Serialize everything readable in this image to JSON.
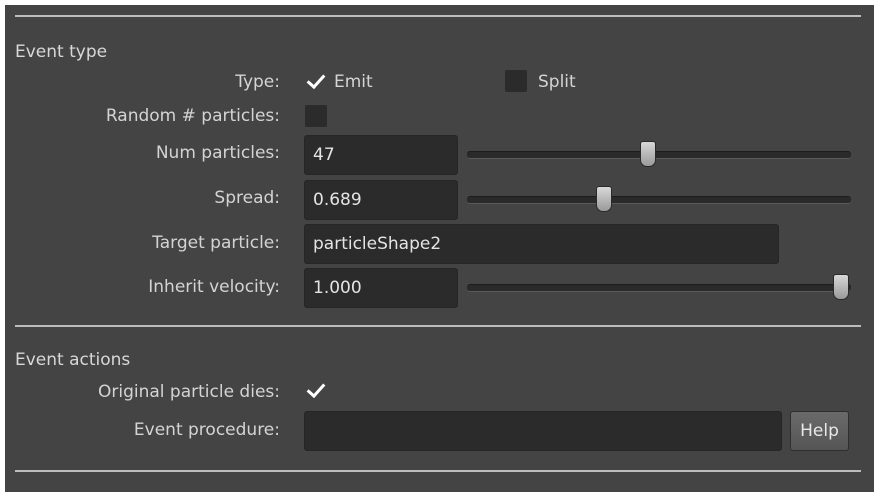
{
  "event_type": {
    "title": "Event type",
    "type_label": "Type:",
    "emit_label": "Emit",
    "emit_checked": true,
    "split_label": "Split",
    "split_checked": false,
    "random_label": "Random # particles:",
    "random_checked": false,
    "num_particles_label": "Num particles:",
    "num_particles_value": "47",
    "num_particles_slider": 0.47,
    "spread_label": "Spread:",
    "spread_value": "0.689",
    "spread_slider": 0.35,
    "target_particle_label": "Target particle:",
    "target_particle_value": "particleShape2",
    "inherit_velocity_label": "Inherit velocity:",
    "inherit_velocity_value": "1.000",
    "inherit_velocity_slider": 1.0
  },
  "event_actions": {
    "title": "Event actions",
    "original_dies_label": "Original particle dies:",
    "original_dies_checked": true,
    "event_procedure_label": "Event procedure:",
    "event_procedure_value": "",
    "help_label": "Help"
  },
  "colors": {
    "panel_bg": "#444444",
    "field_bg": "#2b2b2b",
    "separator": "#bdbdbd",
    "text": "#d4d4d4"
  },
  "icons": {
    "checkmark": "checkmark-icon"
  }
}
